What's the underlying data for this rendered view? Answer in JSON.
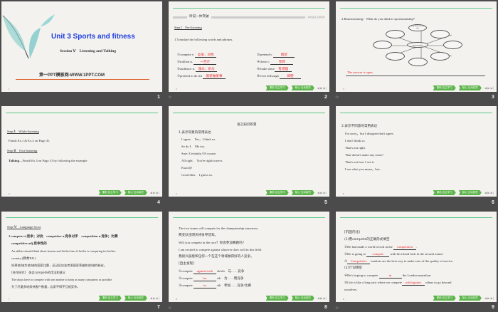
{
  "footer": {
    "btn1": "课前·自主学习",
    "btn2": "核心·互动探究",
    "nav": "◀ ▶ ▶|"
  },
  "slides": [
    {
      "number": "1",
      "title": "Unit 3 Sports and fitness",
      "section": "Section Ⅴ　Listening and Talking",
      "site": "第一PPT模板网-WWW.1PPT.COM",
      "page": "1"
    },
    {
      "number": "2",
      "header": "听说一体突破",
      "header_right": "先听后说 主题深化",
      "step": "Step Ⅰ　Pre-listening",
      "task": "1.Translate the following words and phrases.",
      "items": [
        {
          "q": "①compete v.",
          "a": "竞争；对抗"
        },
        {
          "q": "②pretend v.",
          "a": "假装"
        },
        {
          "q": "③million n.",
          "a": "一百万"
        },
        {
          "q": "④cheat v.",
          "a": "作弊"
        },
        {
          "q": "⑤audience n.",
          "a": "观众；听众"
        },
        {
          "q": "⑥make sense",
          "a": "有道理"
        },
        {
          "q": "⑦pretend to do sth",
          "a": "假装做某事"
        },
        {
          "q": "⑧even if/though",
          "a": "即使"
        }
      ],
      "page": "2"
    },
    {
      "number": "3",
      "question": "2.Brainstorming：What do you think is sportsmanship?",
      "center": "sportsmanship",
      "top_oval": "to try his/her best to win",
      "answer": "The answer is open.",
      "page": "3"
    },
    {
      "number": "4",
      "step2": "Step Ⅱ　While-listening",
      "step2_text": "Finish Ex.1 & Ex.2 on Page 41.",
      "step3": "Step Ⅲ　Post-listening",
      "talking": "Talking",
      "step3_text": "—Finish Ex.3 on Page 41 by following the example.",
      "page": "4"
    },
    {
      "number": "5",
      "title": "语言知识积累",
      "heading": "1.表示同意的常用表达",
      "lines": [
        "I agree.　Yes，I think so.",
        "So do I.　Me too.",
        "Sure./Certainly./Of course.",
        "All right.　You're right/correct.",
        "Exactly!",
        "Good idea.　I guess so."
      ],
      "page": "5"
    },
    {
      "number": "6",
      "heading": "2.表示不同意的常用表达",
      "lines": [
        "I'm sorry，but I disagree/don't agree.",
        "I don't think so.",
        "That's not right.",
        "That doesn't make any sense!",
        "That's not how I see it.",
        "I see what you mean，but..."
      ],
      "page": "6"
    },
    {
      "number": "7",
      "step": "Step Ⅳ　Language focus",
      "l1": "1.compete vi.竞争；对抗　competitor n.竞争对手　competition n.竞争；比赛",
      "l2": "competitive adj.竞争性的",
      "l3": "An athlete should think about honour and his/her fans if he/she is competing for his/her",
      "l4": "country.(教材P41)",
      "l5": "如果他/她为他/她的国家比赛，运动员应该考虑国家荣誉和他/她的粉丝。",
      "l6": "[合作探究]　体会compete的用法和意义",
      "l7": "The shops have to compete with one another to keep as many consumers as possible.",
      "l8": "为了尽量多地保持客户数量，店家不得不互相竞争。",
      "page": "7"
    },
    {
      "number": "8",
      "lines": [
        "The two teams will compete for the championship tomorrow.",
        "两支队伍明天将争夺冠军。",
        "Will you compete in the race？你会参加赛跑吗？",
        "I am excited to compete against whoever does well in this field.",
        "我很兴奋能和任何一个在这个领域做得好的人竞争。",
        "[自主发现]"
      ],
      "fills": [
        {
          "q": "①compete",
          "a": "against/with",
          "s": "sb/sth　与……竞争"
        },
        {
          "q": "②compete",
          "a": "for",
          "s": "sth　为……而竞争"
        },
        {
          "q": "③compete",
          "a": "in",
          "s": "sth　参加……竞争/比赛"
        }
      ],
      "page": "8"
    },
    {
      "number": "9",
      "lines": [
        "[巩固内化]",
        "(1)用compete的正确形式填空"
      ],
      "q1": {
        "pre": "①He had made a world record in the",
        "a": "competition",
        "post": "."
      },
      "q2": {
        "pre": "②He is going to",
        "a": "compete",
        "post": "with his friend Jack in the second round."
      },
      "q3": {
        "pre": "③",
        "a": "Competitive",
        "post": "markets are the best way to make sure of the quality of service."
      },
      "sub2": "(2)介词填空",
      "q4": {
        "pre": "④He's hoping to compete",
        "a": "in",
        "post": "the London marathon."
      },
      "q5": {
        "pre": "⑤Life is like a long race where we compete",
        "a": "with/against",
        "post": "others to go beyond"
      },
      "q5b": "ourselves.",
      "page": "9"
    }
  ]
}
